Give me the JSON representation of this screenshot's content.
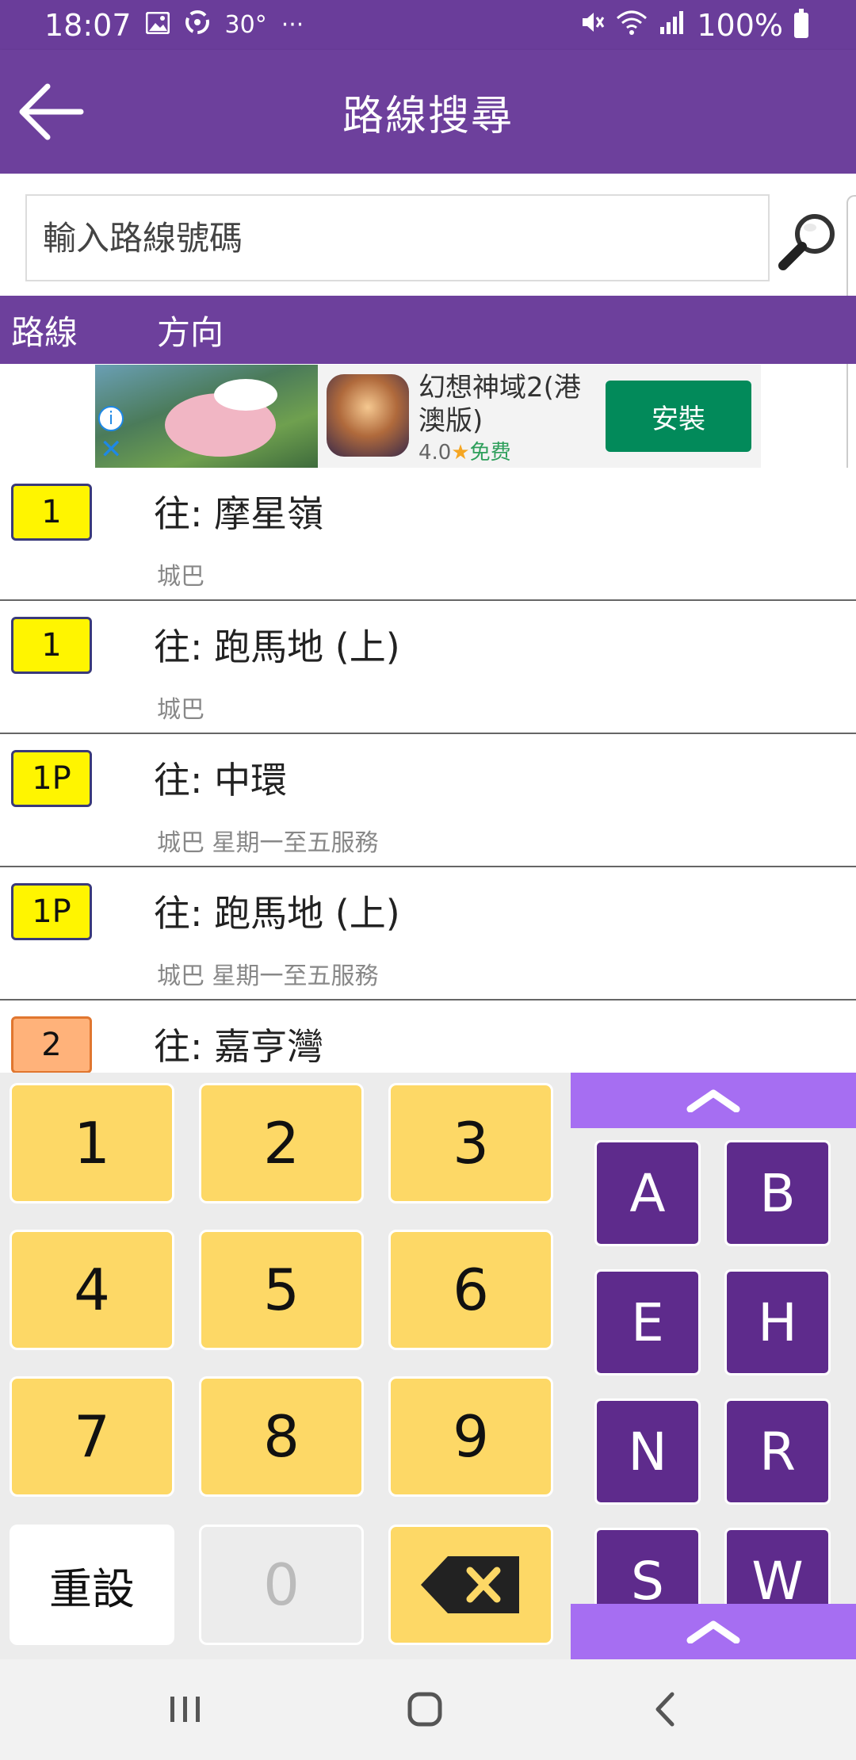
{
  "status_bar": {
    "time": "18:07",
    "temperature": "30°",
    "more": "···",
    "battery": "100%"
  },
  "app_bar": {
    "title": "路線搜尋"
  },
  "search": {
    "placeholder": "輸入路線號碼",
    "value": ""
  },
  "table_header": {
    "route": "路線",
    "direction": "方向"
  },
  "ad": {
    "app_name": "幻想神域2(港澳版)",
    "rating": "4.0",
    "star": "★",
    "price": "免费",
    "install_label": "安裝",
    "info_glyph": "i",
    "close_glyph": "✕"
  },
  "routes": [
    {
      "route": "1",
      "dest": "往: 摩星嶺",
      "info": "城巴",
      "badge_color": "#fff500"
    },
    {
      "route": "1",
      "dest": "往: 跑馬地 (上)",
      "info": "城巴",
      "badge_color": "#fff500"
    },
    {
      "route": "1P",
      "dest": "往: 中環",
      "info": "城巴 星期一至五服務",
      "badge_color": "#fff500"
    },
    {
      "route": "1P",
      "dest": "往: 跑馬地 (上)",
      "info": "城巴 星期一至五服務",
      "badge_color": "#fff500"
    },
    {
      "route": "2",
      "dest": "往: 嘉亨灣",
      "info": "",
      "badge_color": "#ffb27a"
    }
  ],
  "keypad": {
    "digits": [
      "1",
      "2",
      "3",
      "4",
      "5",
      "6",
      "7",
      "8",
      "9"
    ],
    "reset_label": "重設",
    "zero_label": "0",
    "letters": [
      "A",
      "B",
      "E",
      "H",
      "N",
      "R",
      "S",
      "W"
    ]
  },
  "colors": {
    "primary": "#6d409c",
    "key_yellow": "#fdd866",
    "letter_purple": "#5e2b8c",
    "scroll_purple": "#a66ef2",
    "install_green": "#028a5a"
  }
}
